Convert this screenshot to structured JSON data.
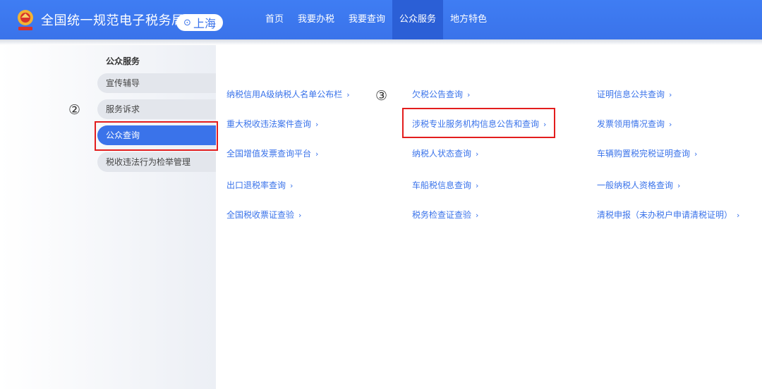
{
  "header": {
    "site_title": "全国统一规范电子税务局",
    "region": "上海",
    "nav": [
      {
        "label": "首页",
        "active": false
      },
      {
        "label": "我要办税",
        "active": false
      },
      {
        "label": "我要查询",
        "active": false
      },
      {
        "label": "公众服务",
        "active": true
      },
      {
        "label": "地方特色",
        "active": false
      }
    ]
  },
  "sidebar": {
    "heading": "公众服务",
    "items": [
      {
        "label": "宣传辅导"
      },
      {
        "label": "服务诉求"
      },
      {
        "label": "公众查询",
        "active": true
      },
      {
        "label": "税收违法行为检举管理"
      }
    ]
  },
  "annotations": {
    "step2": "②",
    "step3": "③"
  },
  "links": {
    "col1": [
      "纳税信用A级纳税人名单公布栏",
      "重大税收违法案件查询",
      "全国增值发票查询平台",
      "出口退税率查询",
      "全国税收票证查验"
    ],
    "col2": [
      "欠税公告查询",
      "涉税专业服务机构信息公告和查询",
      "纳税人状态查询",
      "车船税信息查询",
      "税务检查证查验"
    ],
    "col3": [
      "证明信息公共查询",
      "发票领用情况查询",
      "车辆购置税完税证明查询",
      "一般纳税人资格查询",
      "清税申报（未办税户申请清税证明）"
    ],
    "chevron": "›"
  },
  "colors": {
    "brand_blue": "#3a73ea",
    "nav_active": "#2b5fd6",
    "highlight_red": "#e31d1d"
  }
}
